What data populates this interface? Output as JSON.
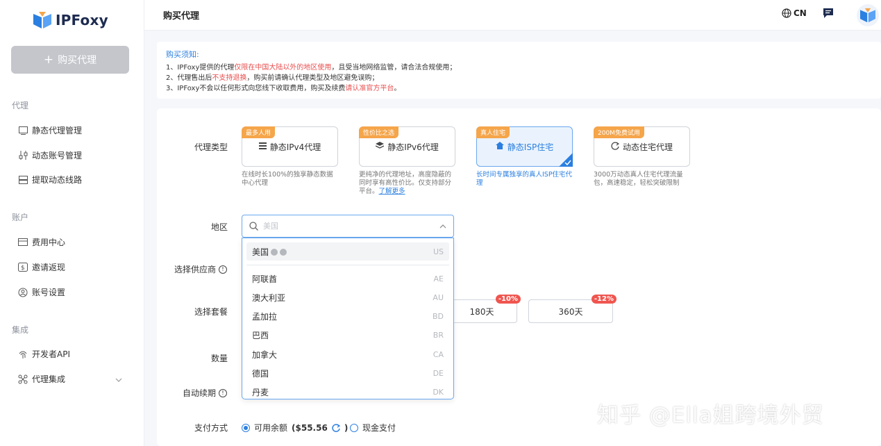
{
  "brand": {
    "name": "IPFoxy"
  },
  "sidebar": {
    "buy_button": "购买代理",
    "sections": [
      {
        "title": "代理",
        "items": [
          "静态代理管理",
          "动态账号管理",
          "提取动态线路"
        ]
      },
      {
        "title": "账户",
        "items": [
          "费用中心",
          "邀请返现",
          "账号设置"
        ]
      },
      {
        "title": "集成",
        "items": [
          "开发者API",
          "代理集成"
        ]
      }
    ]
  },
  "header": {
    "title": "购买代理",
    "lang": "CN"
  },
  "notice": {
    "title": "购买须知:",
    "line1_a": "1、IPFoxy提供的代理",
    "line1_red": "仅限在中国大陆以外的地区使用",
    "line1_b": "，且受当地网络监管，请合法合规使用；",
    "line2_a": "2、代理售出后",
    "line2_red": "不支持退换",
    "line2_b": "，购买前请确认代理类型及地区避免误购；",
    "line3_a": "3、IPFoxy不会以任何形式向您线下收取费用，购买及续费",
    "line3_red": "请认准官方平台",
    "line3_b": "。"
  },
  "labels": {
    "proxy_type": "代理类型",
    "region": "地区",
    "provider": "选择供应商",
    "package": "选择套餐",
    "quantity": "数量",
    "auto_renew": "自动续期",
    "payment": "支付方式"
  },
  "proxy_types": [
    {
      "tag": "最多人用",
      "label": "静态IPv4代理",
      "desc": "在线时长100%的独享静态数据中心代理"
    },
    {
      "tag": "性价比之选",
      "label": "静态IPv6代理",
      "desc": "更纯净的代理地址，高度隐蔽的同时享有高性价比。仅支持部分平台。",
      "link": "了解更多"
    },
    {
      "tag": "真人住宅",
      "label": "静态ISP住宅",
      "desc": "长时间专属独享的真人ISP住宅代理"
    },
    {
      "tag": "200M免费试用",
      "label": "动态住宅代理",
      "desc": "3000万动态真人住宅代理流量包，高速稳定，轻松突破限制"
    }
  ],
  "region_search": {
    "placeholder": "美国"
  },
  "regions": [
    {
      "name": "美国",
      "code": "US"
    },
    {
      "name": "阿联酋",
      "code": "AE"
    },
    {
      "name": "澳大利亚",
      "code": "AU"
    },
    {
      "name": "孟加拉",
      "code": "BD"
    },
    {
      "name": "巴西",
      "code": "BR"
    },
    {
      "name": "加拿大",
      "code": "CA"
    },
    {
      "name": "德国",
      "code": "DE"
    },
    {
      "name": "丹麦",
      "code": "DK"
    }
  ],
  "packages": [
    {
      "label": "180天",
      "discount": "-10%"
    },
    {
      "label": "360天",
      "discount": "-12%"
    }
  ],
  "payment": {
    "balance_label": "可用余额",
    "balance_value": "($55.56",
    "balance_close": ")",
    "cash_label": "现金支付"
  },
  "watermark": "知乎 @Ella姐跨境外贸",
  "colors": {
    "accent": "#2b7fe0",
    "tag": "#f5a54a",
    "danger": "#e84d4d"
  }
}
